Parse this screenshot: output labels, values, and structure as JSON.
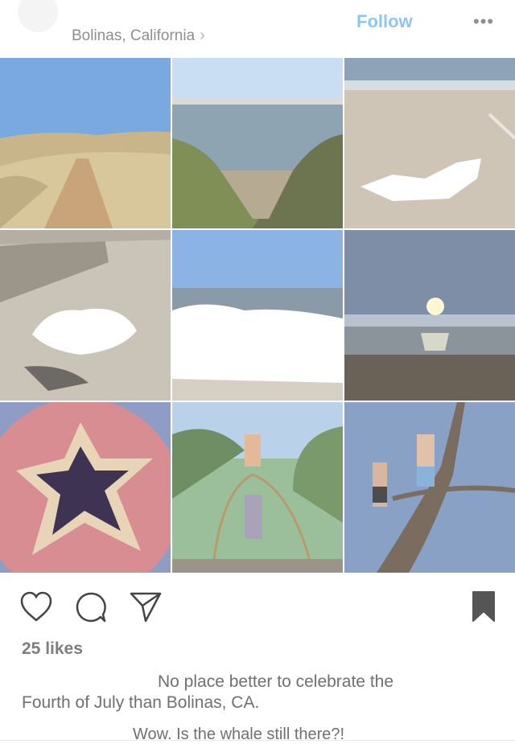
{
  "header": {
    "location": "Bolinas, California",
    "follow_label": "Follow",
    "more_icon": "more-horizontal-icon"
  },
  "grid": {
    "tiles": [
      "dirt-path-hills",
      "ocean-cliff",
      "beach-sand-driftwood",
      "beach-log",
      "ocean-horizon",
      "sunset-beach",
      "blueberry-galette",
      "playground-dome",
      "tree-climbers"
    ]
  },
  "actions": {
    "like_icon": "heart-icon",
    "comment_icon": "comment-icon",
    "share_icon": "send-icon",
    "save_icon": "bookmark-icon"
  },
  "likes": "25 likes",
  "caption": {
    "line1": "No place better to celebrate the",
    "line2": "Fourth of July than Bolinas, CA."
  },
  "comment": "Wow. Is the whale still there?!"
}
